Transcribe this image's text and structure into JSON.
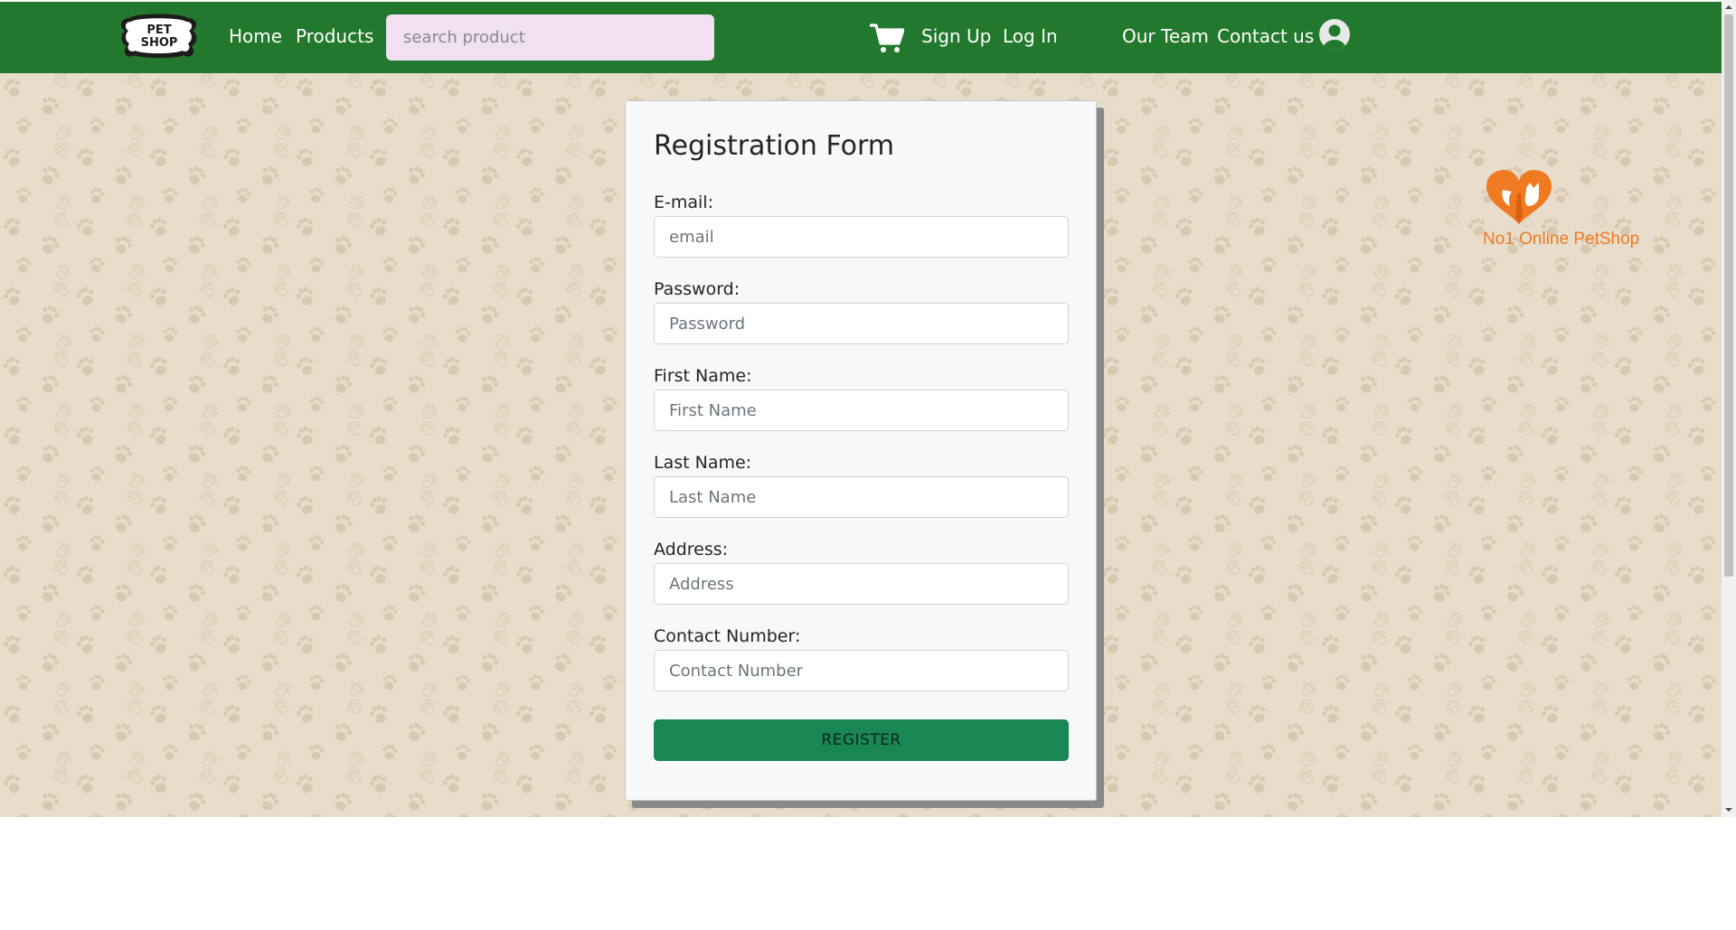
{
  "navbar": {
    "logo_text": [
      "PET",
      "SHOP"
    ],
    "links": {
      "home": "Home",
      "products": "Products",
      "signup": "Sign Up",
      "login": "Log In",
      "team": "Our Team",
      "contact": "Contact us"
    },
    "search_placeholder": "search product",
    "icons": [
      "shopping-cart-icon",
      "user-avatar-icon"
    ],
    "color": "#22792e"
  },
  "form": {
    "title": "Registration Form",
    "fields": [
      {
        "label": "E-mail:",
        "placeholder": "email"
      },
      {
        "label": "Password:",
        "placeholder": "Password"
      },
      {
        "label": "First Name:",
        "placeholder": "First Name"
      },
      {
        "label": "Last Name:",
        "placeholder": "Last Name"
      },
      {
        "label": "Address:",
        "placeholder": "Address"
      },
      {
        "label": "Contact Number:",
        "placeholder": "Contact Number"
      }
    ],
    "submit_label": "REGISTER",
    "button_color": "#198754"
  },
  "brand": {
    "tagline": "No1 Online PetShop",
    "icon": "heart-pets-icon",
    "color": "#f07a22"
  },
  "background": {
    "color": "#e8ddca",
    "pattern": "paw-print-icon"
  }
}
